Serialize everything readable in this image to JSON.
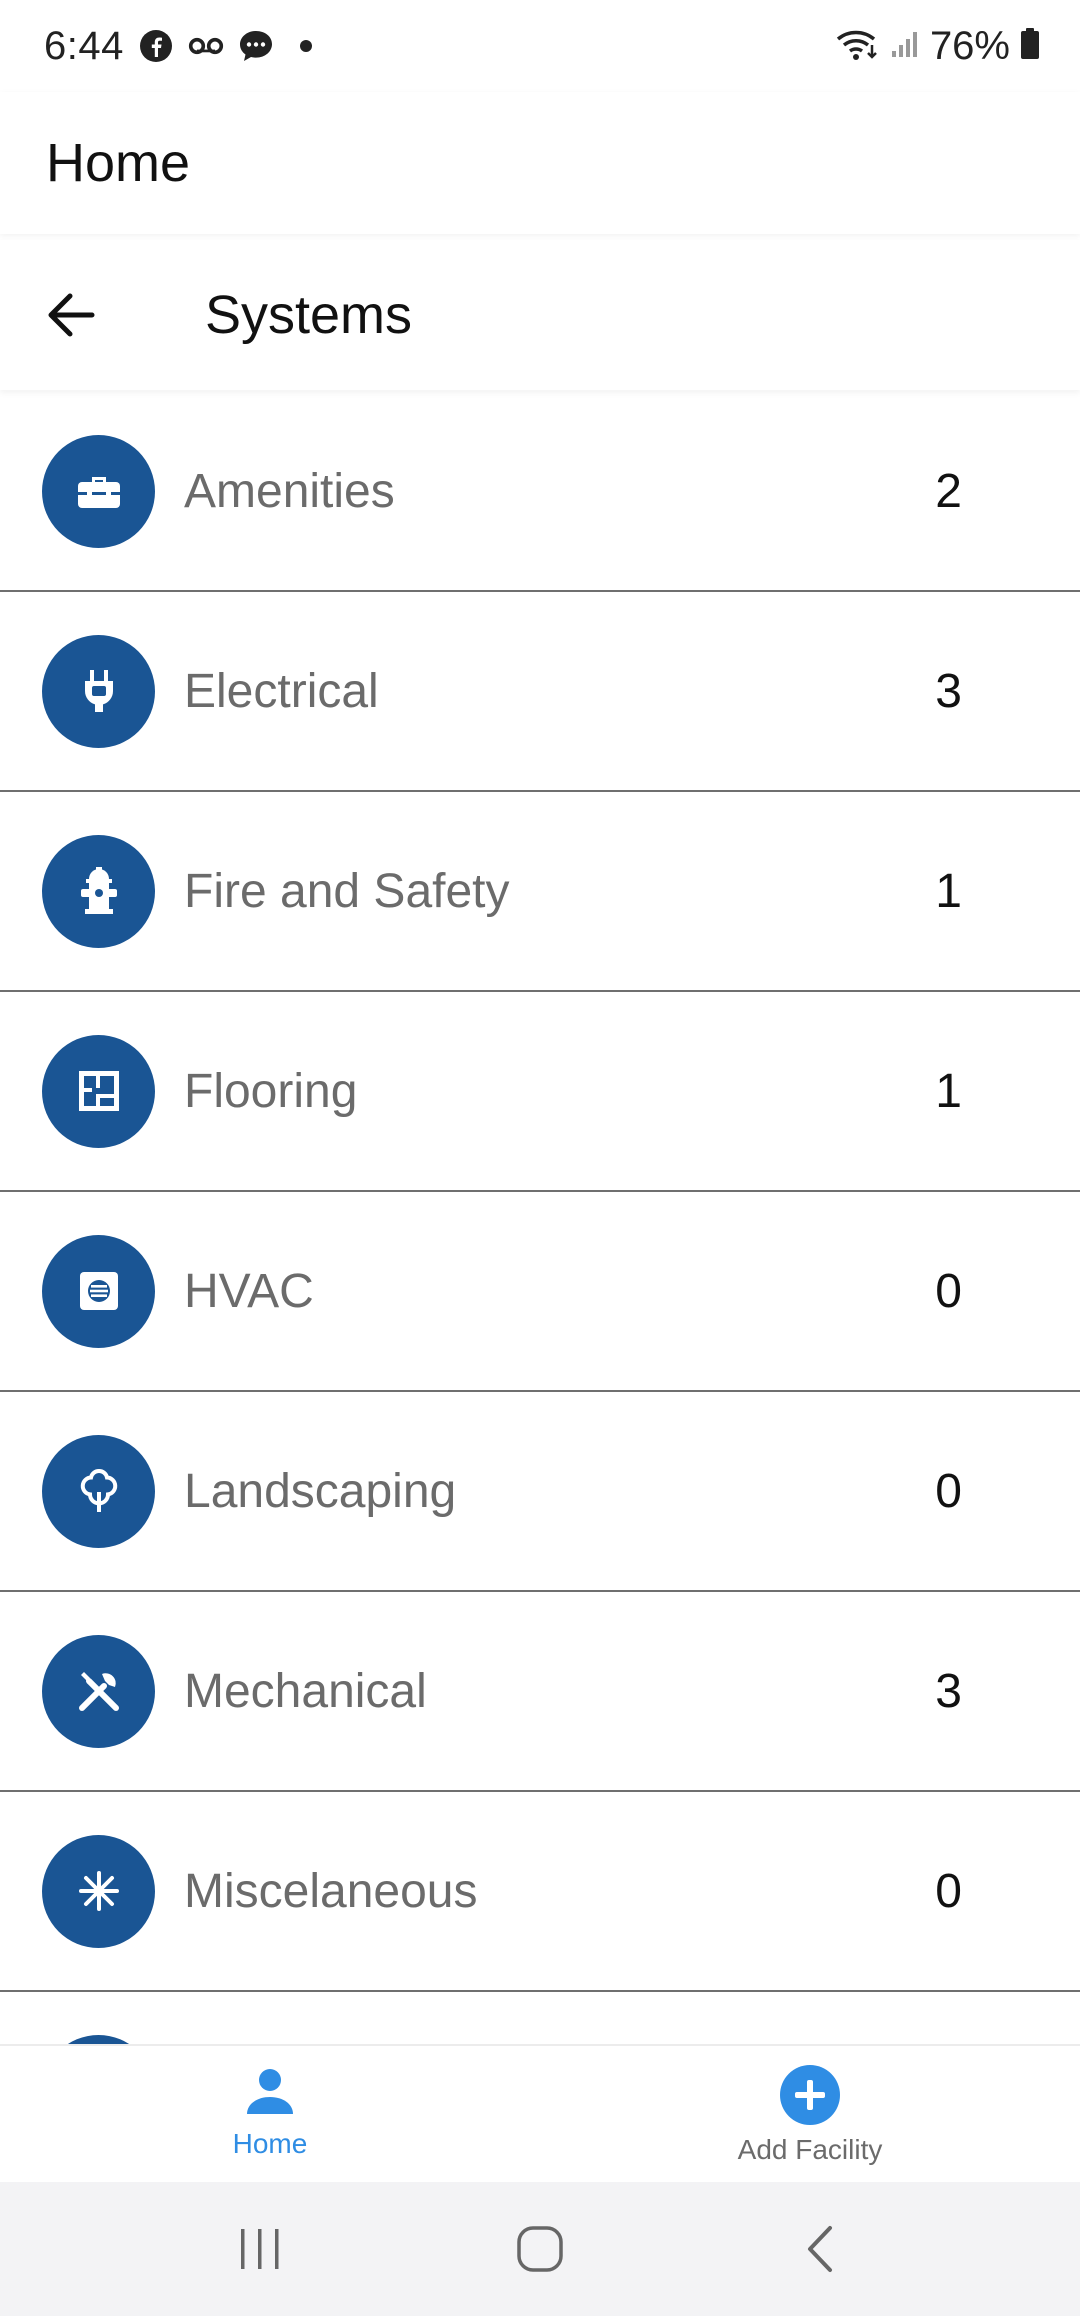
{
  "status_bar": {
    "time": "6:44",
    "battery": "76%"
  },
  "app_bar": {
    "title": "Home"
  },
  "sub_header": {
    "title": "Systems"
  },
  "systems": [
    {
      "label": "Amenities",
      "count": "2",
      "icon": "toolbox-icon"
    },
    {
      "label": "Electrical",
      "count": "3",
      "icon": "plug-icon"
    },
    {
      "label": "Fire and Safety",
      "count": "1",
      "icon": "fire-hydrant-icon"
    },
    {
      "label": "Flooring",
      "count": "1",
      "icon": "floor-plan-icon"
    },
    {
      "label": "HVAC",
      "count": "0",
      "icon": "hvac-vent-icon"
    },
    {
      "label": "Landscaping",
      "count": "0",
      "icon": "tree-icon"
    },
    {
      "label": "Mechanical",
      "count": "3",
      "icon": "tools-icon"
    },
    {
      "label": "Miscelaneous",
      "count": "0",
      "icon": "asterisk-icon"
    }
  ],
  "bottom_nav": {
    "home_label": "Home",
    "add_label": "Add Facility"
  },
  "colors": {
    "icon_circle": "#1a5594",
    "accent": "#2f8de4"
  }
}
